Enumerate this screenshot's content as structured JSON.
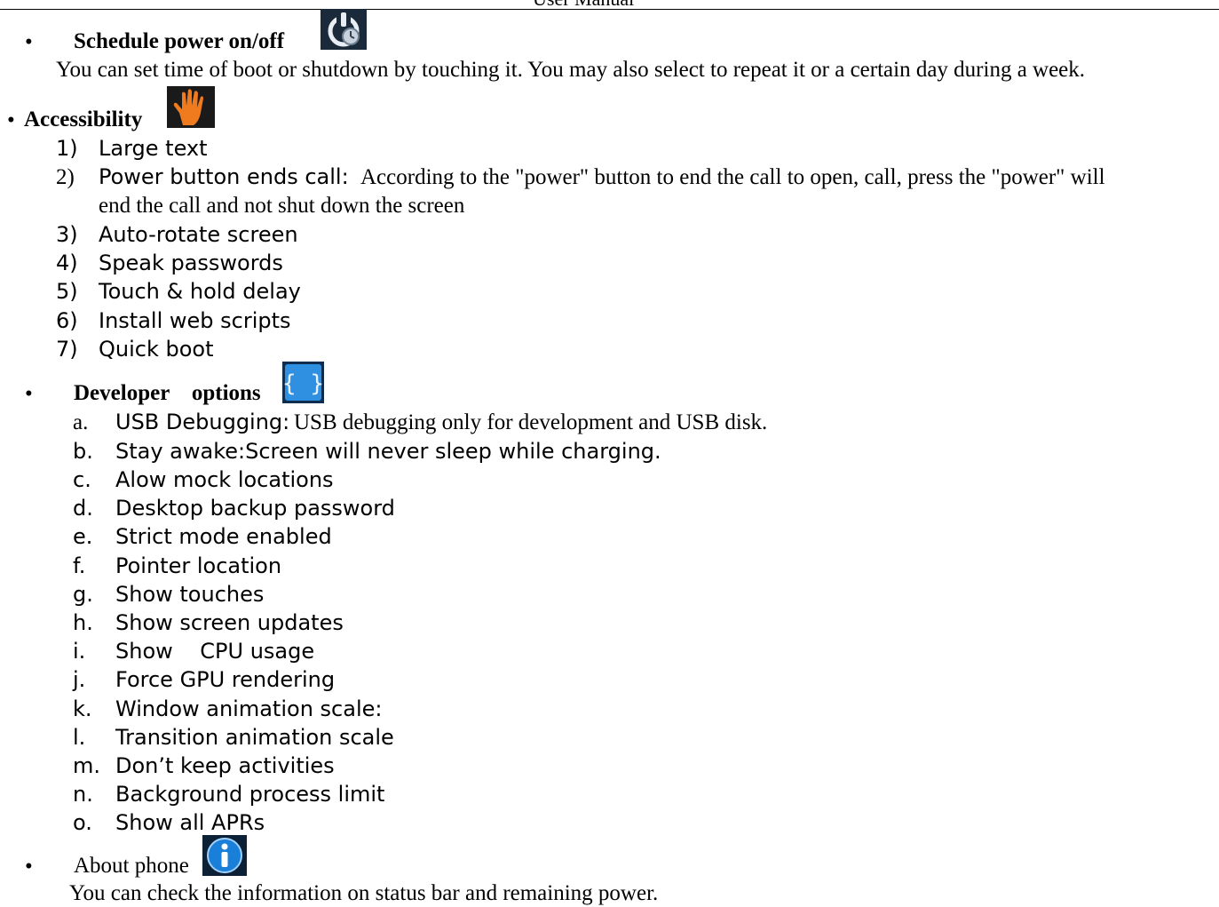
{
  "header": {
    "title_fragment": "User Manual"
  },
  "schedule": {
    "bullet": "•",
    "title": "Schedule power on/off",
    "icon": "power-clock-icon",
    "description": "You can set time of boot or shutdown by touching it. You may also select to repeat it or a certain day during a week."
  },
  "accessibility": {
    "bullet": "•",
    "title": "Accessibility",
    "icon": "hand-icon",
    "items": [
      {
        "num": "1)",
        "label": "Large text"
      },
      {
        "num": "2)",
        "label": "Power button ends call:",
        "desc": "According to the \"power\" button to end the call to open, call, press the \"power\" will",
        "desc2": "end the call and not shut down the screen"
      },
      {
        "num": "3)",
        "label": "Auto-rotate screen"
      },
      {
        "num": "4)",
        "label": "Speak passwords"
      },
      {
        "num": "5)",
        "label": "Touch & hold delay"
      },
      {
        "num": "6)",
        "label": "Install web scripts"
      },
      {
        "num": "7)",
        "label": "Quick boot"
      }
    ]
  },
  "developer": {
    "bullet": "•",
    "title": "Developer    options",
    "icon": "braces-icon",
    "items": [
      {
        "letter": "a.",
        "label": "USB Debugging:",
        "desc": "USB debugging only for development and USB disk."
      },
      {
        "letter": "b.",
        "label": "Stay awake:Screen will never sleep while charging."
      },
      {
        "letter": "c.",
        "label": "Alow mock locations"
      },
      {
        "letter": "d.",
        "label": "Desktop backup password"
      },
      {
        "letter": "e.",
        "label": "Strict mode enabled"
      },
      {
        "letter": "f.",
        "label": "Pointer location"
      },
      {
        "letter": "g.",
        "label": "Show touches"
      },
      {
        "letter": "h.",
        "label": "Show screen updates"
      },
      {
        "letter": "i.",
        "label": "Show    CPU usage"
      },
      {
        "letter": "j.",
        "label": "Force GPU rendering"
      },
      {
        "letter": "k.",
        "label": "Window animation scale:"
      },
      {
        "letter": "l.",
        "label": "Transition animation scale"
      },
      {
        "letter": "m.",
        "label": "Don’t keep activities"
      },
      {
        "letter": "n.",
        "label": "Background process limit"
      },
      {
        "letter": "o.",
        "label": "Show all APRs"
      }
    ]
  },
  "about": {
    "bullet": "•",
    "title": "About phone",
    "icon": "info-icon",
    "description": "You can check the information on status bar and remaining power."
  },
  "colors": {
    "hand_icon": "#f07a1e",
    "braces_icon": "#2f8fe0",
    "info_icon": "#1a7fd8"
  }
}
